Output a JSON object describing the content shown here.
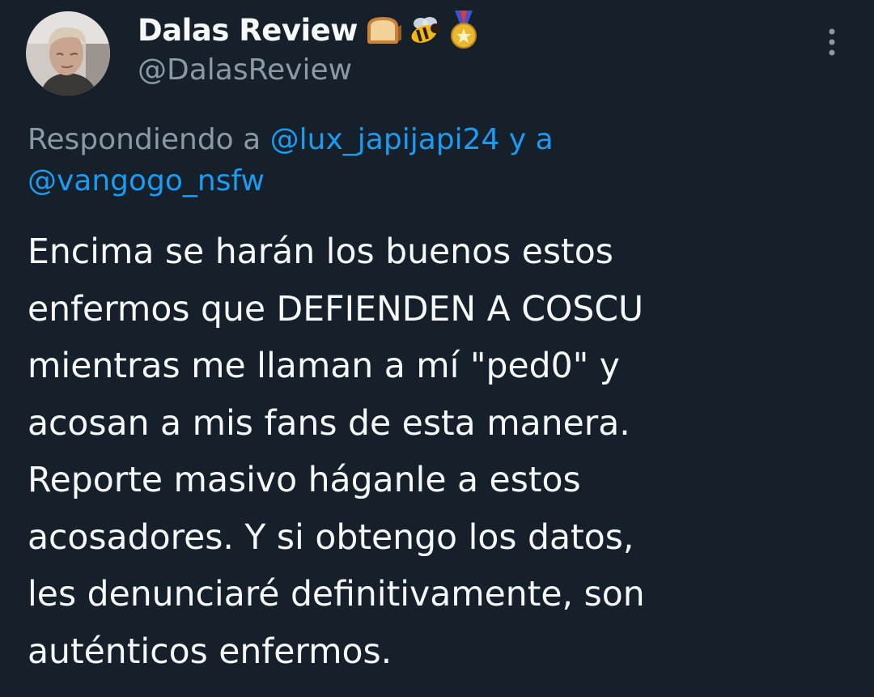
{
  "author": {
    "display_name": "Dalas Review",
    "handle": "@DalasReview",
    "badges": [
      "bread-icon",
      "bee-icon",
      "medal-icon"
    ]
  },
  "reply_context": {
    "prefix": "Respondiendo a",
    "mention_1": "@lux_japijapi24",
    "connector": "y a",
    "mention_2": "@vangogo_nsfw"
  },
  "tweet": {
    "lines": [
      "Encima se harán los buenos estos",
      "enfermos que DEFIENDEN A COSCU",
      "mientras me llaman a mí \"ped0\" y",
      "acosan a mis fans de esta manera.",
      "Reporte masivo háganle a estos",
      "acosadores. Y si obtengo los datos,",
      "les denunciaré definitivamente, son",
      "auténticos enfermos."
    ]
  },
  "colors": {
    "background": "#15202b",
    "text_primary": "#f7f9f9",
    "text_secondary": "#8b98a5",
    "link": "#1d9bf0"
  },
  "icons": {
    "more": "more-vertical-icon"
  }
}
